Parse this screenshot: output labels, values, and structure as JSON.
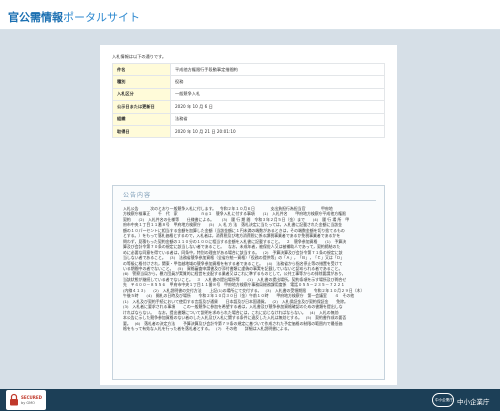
{
  "header": {
    "brand_main": "官公需情報",
    "brand_sub": "ポータルサイト"
  },
  "intro_text": "入札情報は以下の通りです。",
  "info_rows": [
    {
      "label": "件名",
      "value": "平成他方権限行手段動事定措間約"
    },
    {
      "label": "種別",
      "value": "役務"
    },
    {
      "label": "入札区分",
      "value": "一般競争入札"
    },
    {
      "label": "公示日または更新日",
      "value": "2020 年 10 月 6 日"
    },
    {
      "label": "組織",
      "value": "法務省"
    },
    {
      "label": "取得日",
      "value": "2020 年 10 月 21 日 20:01:10"
    }
  ],
  "notice": {
    "title": "公告内容",
    "lines": [
      "入札公告　　　次のとおり一般競争入札に付します。　令和２年１０月６日　　　　支出負担行為担当官　　　　甲府地",
      "方検察庁検事正　　千　代　家　　　　　　ｎ◎１　競争入札に付する事項　　(1)　入札件名　　甲府地方検察庁平成他方権限",
      "契約　　(2)　入札件名の仕様等　　仕様書による。　　(3)　履 行 期 間　令和３年２月５日（金）まで　　(4)　履 行 場 所　甲",
      "府市中央１丁目１１番８号　甲府地方検察庁　　(5)　入 札 方 法　落札決定に当たっては，入札書に記載された金額に当該金",
      "額の１０パーセントに相当する金額を加算した金額（当該金額に１円未満の端数があるときは，その端数金額を切り捨てるもの",
      "とする。）をもって落札価格とするので，入札者は，消費税及び地方消費税に係る課税事業者であるか免税事業者であるかを",
      "問わず，見積もった契約金額の１１０分の１００に相当する金額を入札書に記載すること。　２　競争参加資格　　(1)　予算決",
      "算及び会計令第７０条の規定に該当しない者であること。　なお，未成年者，被保佐人又は被補助人であって，契約締結のた",
      "めに必要な同意を得ている者は，同条中，特別の理由がある場合に該当する。　(2)　予算決算及び会計令第７１条の規定に該",
      "当しない者であること。　(3)　法務省競争参加資格（全省庁統一資格）「役務の提供等」の「Ａ」，「Ｂ」，「Ｃ」又は「Ｄ」",
      "の等級に格付けされ，関東・甲信越地域の競争参加資格を有する者であること。　(4)　法務省から指名停止等の措置を受けて",
      "いる期間中の者でないこと。　(5)　資格審査申請書及び添付書類に虚偽の事実を記載していないと認められる者であること。",
      "(6)　警察当局から，暴力団員が実質的に経営を支配する業者又はこれに準ずるものとして，公共工事等からの排除要請があり，",
      "当該状態が継続している者でないこと。　３　入札書の提出場所等　　(1)　入札書の提出場所，契約条項を示す場所及び問合せ",
      "先　〒４００－８５５６　甲府市中央１丁目１１番８号　甲府地方検察庁事務局総務課用度係　電話０５５－２３５－７２２１",
      "(内線４１３)　　(2)　入札説明書の交付方法　　上記(1)の場所にて交付する。　(3)　入札書の受領期限　　令和２年１０月２９日（木）",
      "午後５時　　(4)　開札の日時及び場所　　令和２年１０月３０日（金）午前１０時　　甲府地方検察庁　第一会議室　　４　その他",
      "(1)　入札及び契約手続において使用する言語及び通貨　　日本語及び日本国通貨。　(2)　入札保証金及び契約保証金　　免除。",
      "(3)　入札者に要求される事項　　この一般競争に参加を希望する者は，入札書及び競争参加資格確認のための書類を提出しな",
      "ければならない。　なお，提出書類について説明を求められた場合には，これに応じなければならない。　(4)　入札の無効",
      "本公告に示した競争参加資格のない者のした入札及び入札に関する条件に違反した入札は無効とする。　(5)　契約書作成の要否",
      "要。　(6)　落札者の決定方法　　予算決算及び会計令第７９条の規定に基づいて作成された予定価格の制限の範囲内で最低価",
      "格をもって有効な入札を行った者を落札者とする。　(7)　その他　　詳細は入札説明書による。"
    ]
  },
  "footer": {
    "security_line1": "SECURED",
    "security_line2": "by GMO",
    "agency_mark_text": "中小企業庁",
    "agency_name": "中小企業庁"
  },
  "colors": {
    "brand_blue": "#1a6fb1",
    "page_bg": "#d6dfe7",
    "label_bg": "#fffbd9",
    "footer_bg": "#1c3f57"
  }
}
